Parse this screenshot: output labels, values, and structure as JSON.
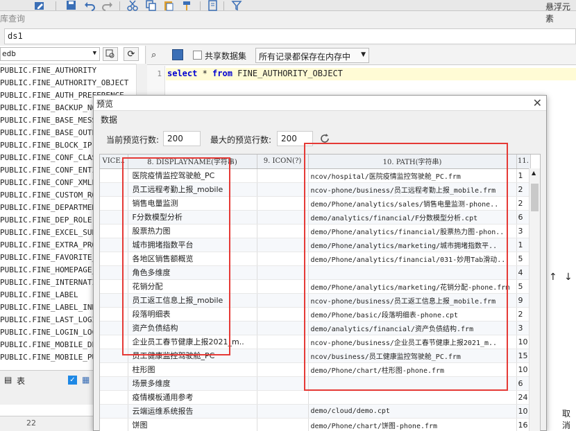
{
  "toolbar": {
    "float_label": "悬浮元素"
  },
  "window": {
    "title": "库查询"
  },
  "datasource": {
    "name": "ds1"
  },
  "left_panel": {
    "db_select": "edb",
    "tables": [
      "PUBLIC.FINE_AUTHORITY",
      "PUBLIC.FINE_AUTHORITY_OBJECT",
      "PUBLIC.FINE_AUTH_PREFERENCE",
      "PUBLIC.FINE_BACKUP_NODE",
      "PUBLIC.FINE_BASE_MESSAGE",
      "PUBLIC.FINE_BASE_OUTPUT",
      "PUBLIC.FINE_BLOCK_IP",
      "PUBLIC.FINE_CONF_CLASSNAME",
      "PUBLIC.FINE_CONF_ENTITY",
      "PUBLIC.FINE_CONF_XMLENTITY",
      "PUBLIC.FINE_CUSTOM_ROLE",
      "PUBLIC.FINE_DEPARTMENT",
      "PUBLIC.FINE_DEP_ROLE",
      "PUBLIC.FINE_EXCEL_SUBMIT",
      "PUBLIC.FINE_EXTRA_PROPERTY",
      "PUBLIC.FINE_FAVORITE_ENTRY",
      "PUBLIC.FINE_HOMEPAGE_EXPAND",
      "PUBLIC.FINE_INTERNATIONAL",
      "PUBLIC.FINE_LABEL",
      "PUBLIC.FINE_LABEL_INDEX",
      "PUBLIC.FINE_LAST_LOGIN",
      "PUBLIC.FINE_LOGIN_LOCK",
      "PUBLIC.FINE_MOBILE_DEVICE",
      "PUBLIC.FINE_MOBILE_PUSH"
    ],
    "bottom_label": "表",
    "line_number": "22"
  },
  "query_bar": {
    "share_label": "共享数据集",
    "memory_select": "所有记录都保存在内存中"
  },
  "editor": {
    "line_no": "1",
    "kw_select": "select",
    "star": " * ",
    "kw_from": "from",
    "table": " FINE_AUTHORITY_OBJECT"
  },
  "dialog": {
    "title": "预览",
    "section": "数据",
    "current_rows_label": "当前预览行数:",
    "current_rows": "200",
    "max_rows_label": "最大的预览行数:",
    "max_rows": "200",
    "columns": [
      "VICE..",
      "8. DISPLAYNAME(字符串)",
      "9. ICON(?)",
      "10. PATH(字符串)",
      "11."
    ],
    "rows": [
      {
        "name": "医院疫情监控驾驶舱_PC",
        "path": "ncov/hospital/医院疫情监控驾驶舱_PC.frm",
        "n": "1"
      },
      {
        "name": "员工远程考勤上报_mobile",
        "path": "ncov-phone/business/员工远程考勤上报_mobile.frm",
        "n": "2"
      },
      {
        "name": "销售电量监测",
        "path": "demo/Phone/analytics/sales/销售电量监测-phone..",
        "n": "2"
      },
      {
        "name": "F分数模型分析",
        "path": "demo/analytics/financial/F分数模型分析.cpt",
        "n": "6"
      },
      {
        "name": "股票热力图",
        "path": "demo/Phone/analytics/financial/股票热力图-phon..",
        "n": "3"
      },
      {
        "name": "城市拥堵指数平台",
        "path": "demo/Phone/analytics/marketing/城市拥堵指数平..",
        "n": "1"
      },
      {
        "name": "各地区销售额概览",
        "path": "demo/Phone/analytics/financial/031-妙用Tab滑动..",
        "n": "5"
      },
      {
        "name": "角色多维度",
        "path": "",
        "n": "4"
      },
      {
        "name": "花销分配",
        "path": "demo/Phone/analytics/marketing/花销分配-phone.frm",
        "n": "5"
      },
      {
        "name": "员工返工信息上报_mobile",
        "path": "ncov-phone/business/员工返工信息上报_mobile.frm",
        "n": "9"
      },
      {
        "name": "段落明细表",
        "path": "demo/Phone/basic/段落明细表-phone.cpt",
        "n": "2"
      },
      {
        "name": "资产负债结构",
        "path": "demo/analytics/financial/资产负债结构.frm",
        "n": "3"
      },
      {
        "name": "企业员工春节健康上报2021_m..",
        "path": "ncov-phone/business/企业员工春节健康上报2021_m..",
        "n": "10"
      },
      {
        "name": "员工健康监控驾驶舱_PC",
        "path": "ncov/business/员工健康监控驾驶舱_PC.frm",
        "n": "15"
      },
      {
        "name": "柱形图",
        "path": "demo/Phone/chart/柱形图-phone.frm",
        "n": "10"
      },
      {
        "name": "场景多维度",
        "path": "",
        "n": "6"
      },
      {
        "name": "疫情模板通用参考",
        "path": "",
        "n": "24"
      },
      {
        "name": "云端运维系统报告",
        "path": "demo/cloud/demo.cpt",
        "n": "10"
      },
      {
        "name": "饼图",
        "path": "demo/Phone/chart/饼图-phone.frm",
        "n": "16"
      }
    ]
  },
  "corner": {
    "cancel_label": "取消"
  },
  "colors": {
    "highlight_box": "#e53935",
    "accent": "#1e88e5"
  }
}
